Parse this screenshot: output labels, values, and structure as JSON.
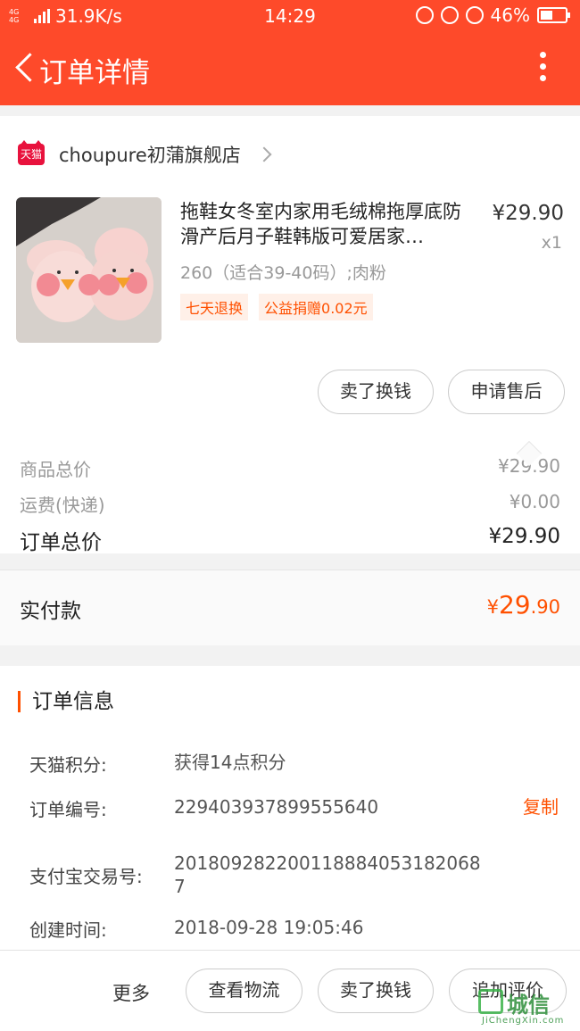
{
  "status_bar": {
    "network": "4G 4G",
    "speed": "31.9K/s",
    "time": "14:29",
    "battery": "46%"
  },
  "nav": {
    "title": "订单详情"
  },
  "shop": {
    "badge": "天猫",
    "name": "choupure初蒲旗舰店"
  },
  "product": {
    "title": "拖鞋女冬室内家用毛绒棉拖厚底防滑产后月子鞋韩版可爱居家…",
    "price": "¥29.90",
    "quantity": "x1",
    "sku": "260（适合39-40码）;肉粉",
    "tags": [
      "七天退换",
      "公益捐赠0.02元"
    ]
  },
  "item_actions": {
    "sell_label": "卖了换钱",
    "after_sale_label": "申请售后"
  },
  "summary": {
    "goods_total_label": "商品总价",
    "goods_total_value": "¥29.90",
    "shipping_label": "运费(快递)",
    "shipping_value": "¥0.00",
    "order_total_label": "订单总价",
    "order_total_value": "¥29.90"
  },
  "paid": {
    "label": "实付款",
    "currency": "¥",
    "integer": "29",
    "decimal": ".90"
  },
  "order_info": {
    "title": "订单信息",
    "rows": [
      {
        "key": "天猫积分:",
        "value": "获得14点积分"
      },
      {
        "key": "订单编号:",
        "value": "229403937899555640"
      },
      {
        "key": "支付宝交易号:",
        "value": "2018092822001188840531820687"
      },
      {
        "key": "创建时间:",
        "value": "2018-09-28 19:05:46"
      }
    ],
    "copy_label": "复制"
  },
  "bottom_bar": {
    "more_label": "更多",
    "logistics_label": "查看物流",
    "sell_label": "卖了换钱",
    "review_label": "追加评价"
  },
  "watermark": {
    "text": "城信",
    "sub": "JiChengXin.com"
  },
  "colors": {
    "brand": "#fe4a2a",
    "accent": "#ff5000",
    "tmall": "#e8123d"
  }
}
